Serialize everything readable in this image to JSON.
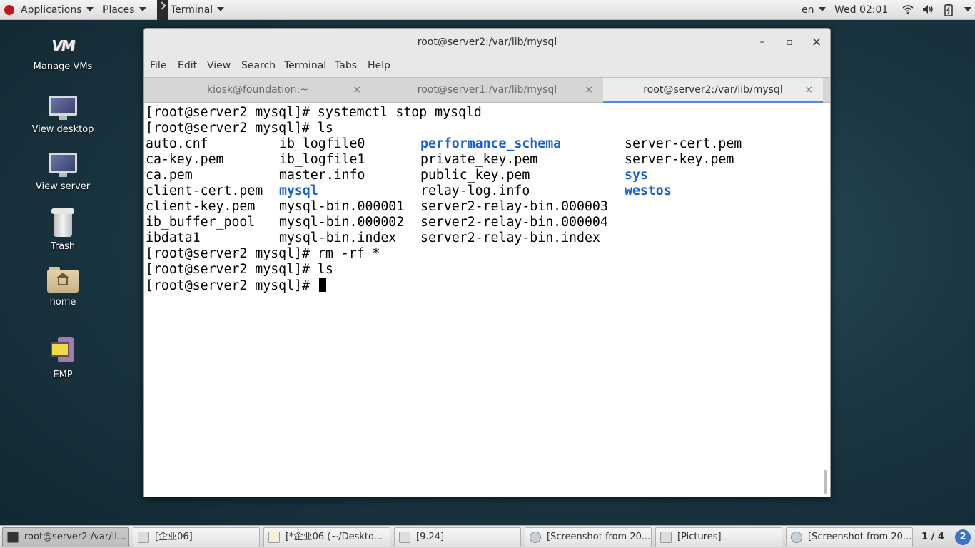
{
  "top_panel": {
    "applications": "Applications",
    "places": "Places",
    "terminal": "Terminal",
    "language": "en",
    "clock": "Wed 02:01",
    "icons": [
      "wifi-icon",
      "volume-icon",
      "battery-icon",
      "power-icon"
    ]
  },
  "desktop": {
    "icons": [
      {
        "label": "Manage VMs",
        "icon": "vm-icon"
      },
      {
        "label": "View desktop",
        "icon": "monitor-icon"
      },
      {
        "label": "View server",
        "icon": "monitor-icon"
      },
      {
        "label": "Trash",
        "icon": "trash-icon"
      },
      {
        "label": "home",
        "icon": "home-folder-icon"
      },
      {
        "label": "EMP",
        "icon": "emp-icon"
      }
    ]
  },
  "window": {
    "title": "root@server2:/var/lib/mysql",
    "controls": {
      "minimize": "–",
      "maximize": "▫",
      "close": "×"
    },
    "menu": [
      "File",
      "Edit",
      "View",
      "Search",
      "Terminal",
      "Tabs",
      "Help"
    ],
    "tabs": [
      {
        "label": "kiosk@foundation:~",
        "active": false
      },
      {
        "label": "root@server1:/var/lib/mysql",
        "active": false
      },
      {
        "label": "root@server2:/var/lib/mysql",
        "active": true
      }
    ],
    "tab_close": "×"
  },
  "terminal": {
    "lines": [
      "[root@server2 mysql]# systemctl stop mysqld",
      "[root@server2 mysql]# ls"
    ],
    "listing": [
      [
        "auto.cnf",
        "ib_logfile0",
        "performance_schema",
        "server-cert.pem"
      ],
      [
        "ca-key.pem",
        "ib_logfile1",
        "private_key.pem",
        "server-key.pem"
      ],
      [
        "ca.pem",
        "master.info",
        "public_key.pem",
        "sys"
      ],
      [
        "client-cert.pem",
        "mysql",
        "relay-log.info",
        "westos"
      ],
      [
        "client-key.pem",
        "mysql-bin.000001",
        "server2-relay-bin.000003",
        ""
      ],
      [
        "ib_buffer_pool",
        "mysql-bin.000002",
        "server2-relay-bin.000004",
        ""
      ],
      [
        "ibdata1",
        "mysql-bin.index",
        "server2-relay-bin.index",
        ""
      ]
    ],
    "directories": [
      "performance_schema",
      "sys",
      "mysql",
      "westos"
    ],
    "after_lines": [
      "[root@server2 mysql]# rm -rf *",
      "[root@server2 mysql]# ls",
      "[root@server2 mysql]# "
    ]
  },
  "taskbar": {
    "tasks": [
      {
        "label": "root@server2:/var/li...",
        "icon": "terminal-icon",
        "active": true
      },
      {
        "label": "[企业06]",
        "icon": "document-icon",
        "active": false
      },
      {
        "label": "[*企业06 (~/Deskto...",
        "icon": "text-editor-icon",
        "active": false
      },
      {
        "label": "[9.24]",
        "icon": "document-icon",
        "active": false
      },
      {
        "label": "[Screenshot from 20...",
        "icon": "image-viewer-icon",
        "active": false
      },
      {
        "label": "[Pictures]",
        "icon": "document-icon",
        "active": false
      },
      {
        "label": "[Screenshot from 20...",
        "icon": "image-viewer-icon",
        "active": false
      }
    ],
    "workspace": "1 / 4",
    "workspace_badge": "2"
  }
}
